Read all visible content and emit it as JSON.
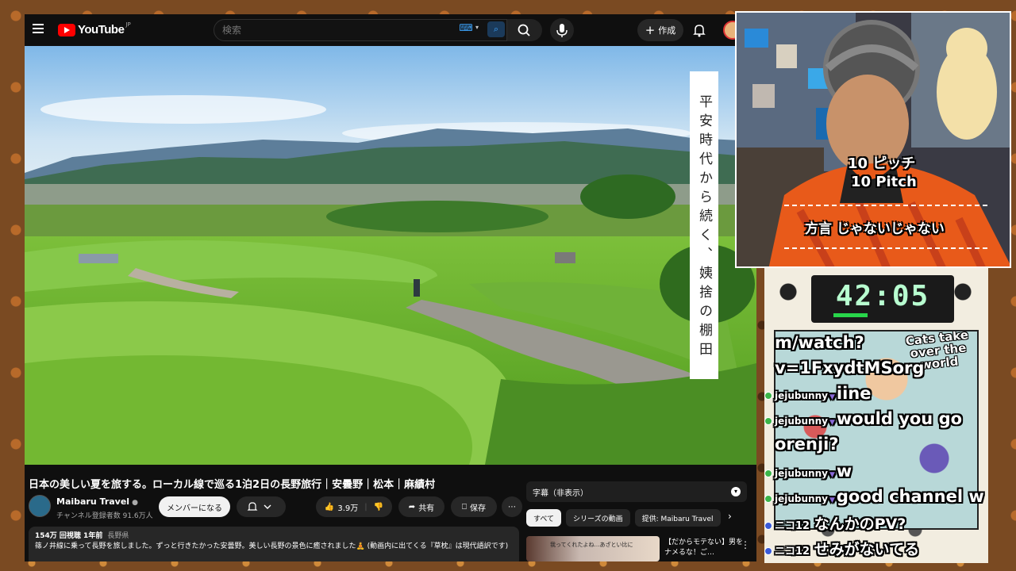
{
  "youtube": {
    "logo_text": "YouTube",
    "logo_region": "JP",
    "search_placeholder": "検索",
    "create_label": "作成",
    "video_side_title": "平安時代から続く、姨捨の棚田",
    "video_title": "日本の美しい夏を旅する。ローカル線で巡る1泊2日の長野旅行｜安曇野｜松本｜麻績村",
    "channel": {
      "name": "Maibaru Travel",
      "subscribers": "チャンネル登録者数 91.6万人"
    },
    "member_button": "メンバーになる",
    "like_count": "3.9万",
    "share_label": "共有",
    "save_label": "保存",
    "description": {
      "stats": "154万 回視聴  1年前",
      "location": "長野県",
      "text": "篠ノ井線に乗って長野を旅しました。ずっと行きたかった安曇野。美しい長野の景色に癒されました🧘 (動画内に出てくる『草枕』は現代語訳です)"
    },
    "subtitles_label": "字幕（非表示）",
    "chips": [
      "すべて",
      "シリーズの動画",
      "提供: Maibaru Travel"
    ],
    "recommendation": {
      "thumb_text": "我ってくれたよね…あざとい比に",
      "title": "【だからモテない】男をナメるな！ご…"
    }
  },
  "webcam": {
    "caption_line1": "10 ピッチ",
    "caption_line2": "10 Pitch",
    "caption_line3": "方言 じゃないじゃない"
  },
  "timer": {
    "text": "42:05",
    "progress": 0.35
  },
  "chat": {
    "title": "Cats take over the world",
    "lines": [
      {
        "type": "text",
        "text": "m/watch?"
      },
      {
        "type": "text",
        "text": "v=1FxydtMSorg"
      },
      {
        "type": "msg",
        "user": "jejubunny",
        "text": "iine"
      },
      {
        "type": "msg",
        "user": "jejubunny",
        "text": "would you go"
      },
      {
        "type": "text",
        "text": "orenji?"
      },
      {
        "type": "msg",
        "user": "jejubunny",
        "text": "w"
      },
      {
        "type": "msg",
        "user": "jejubunny",
        "text": "good channel w"
      },
      {
        "type": "niko",
        "user": "ニコ12",
        "text": "なんかのPV?"
      },
      {
        "type": "niko",
        "user": "ニコ12",
        "text": "せみがないてる"
      }
    ]
  },
  "colors": {
    "youtube_bg": "#0f0f0f",
    "youtube_red": "#ff0000",
    "timer_green": "#28d64a"
  }
}
